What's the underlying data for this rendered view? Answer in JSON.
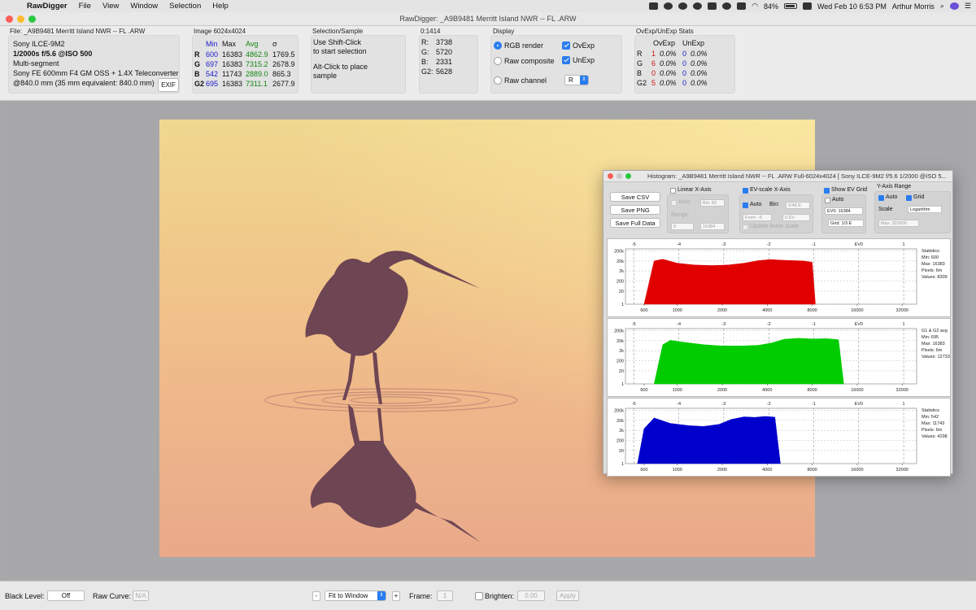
{
  "menubar": {
    "app_name": "RawDigger",
    "items": [
      "File",
      "View",
      "Window",
      "Selection",
      "Help"
    ],
    "battery": "84%",
    "datetime": "Wed Feb 10  6:53 PM",
    "user": "Arthur Morris"
  },
  "window": {
    "title": "RawDigger: _A9B9481  Merritt Island NWR -- FL .ARW"
  },
  "file_panel": {
    "file_label": "File: _A9B9481  Merritt Island NWR -- FL .ARW",
    "camera": "Sony ILCE-9M2",
    "exposure": "1/2000s f/5.6 @ISO 500",
    "metering": "Multi-segment",
    "lens": "Sony FE 600mm F4 GM OSS + 1.4X Teleconverter",
    "focal": "@840.0 mm (35 mm equivalent: 840.0 mm)",
    "exif_button": "EXIF"
  },
  "image_panel": {
    "title": "Image 6024x4024",
    "headers": [
      "Min",
      "Max",
      "Avg",
      "σ"
    ],
    "rows": [
      {
        "ch": "R",
        "min": "600",
        "max": "16383",
        "avg": "4862.9",
        "sd": "1769.5"
      },
      {
        "ch": "G",
        "min": "697",
        "max": "16383",
        "avg": "7315.2",
        "sd": "2678.9"
      },
      {
        "ch": "B",
        "min": "542",
        "max": "11743",
        "avg": "2889.0",
        "sd": "865.3"
      },
      {
        "ch": "G2",
        "min": "695",
        "max": "16383",
        "avg": "7311.1",
        "sd": "2677.9"
      }
    ]
  },
  "selection_panel": {
    "title": "Selection/Sample",
    "line1": "Use Shift-Click",
    "line2": "to start selection",
    "line3": "Alt-Click to place",
    "line4": "sample"
  },
  "sample_panel": {
    "title": "0:1414",
    "rows": [
      {
        "ch": "R:",
        "val": "3738"
      },
      {
        "ch": "G:",
        "val": "5720"
      },
      {
        "ch": "B:",
        "val": "2331"
      },
      {
        "ch": "G2:",
        "val": "5628"
      }
    ]
  },
  "display_panel": {
    "title": "Display",
    "rgb_render": "RGB render",
    "raw_composite": "Raw composite",
    "raw_channel": "Raw channel",
    "ovexp": "OvExp",
    "unexp": "UnExp",
    "channel_value": "R"
  },
  "stats_panel": {
    "title": "OvExp/UnExp Stats",
    "headers": [
      "OvExp",
      "UnExp"
    ],
    "rows": [
      {
        "ch": "R",
        "ov_n": "1",
        "ov_p": "0.0%",
        "un_n": "0",
        "un_p": "0.0%"
      },
      {
        "ch": "G",
        "ov_n": "6",
        "ov_p": "0.0%",
        "un_n": "0",
        "un_p": "0.0%"
      },
      {
        "ch": "B",
        "ov_n": "0",
        "ov_p": "0.0%",
        "un_n": "0",
        "un_p": "0.0%"
      },
      {
        "ch": "G2",
        "ov_n": "5",
        "ov_p": "0.0%",
        "un_n": "0",
        "un_p": "0.0%"
      }
    ]
  },
  "bottombar": {
    "black_level_label": "Black Level:",
    "black_level_value": "Off",
    "raw_curve_label": "Raw Curve:",
    "raw_curve_value": "N/A",
    "minus": "-",
    "plus": "+",
    "zoom_value": "Fit to Window",
    "frame_label": "Frame:",
    "frame_value": "1",
    "brighten_label": "Brighten:",
    "brighten_value": "0.00",
    "apply_label": "Apply"
  },
  "histogram": {
    "title": "Histogram: _A9B9481  Merritt Island NWR -- FL .ARW Full-6024x4024 [ Sony ILCE-9M2 f/5.6 1/2000 @ISO 5...",
    "save_csv": "Save CSV",
    "save_png": "Save PNG",
    "save_full": "Save Full Data",
    "linear_x": "Linear X-Axis",
    "auto": "Auto",
    "bin_field": "Bin: 82",
    "range_label": "Range:",
    "range_from": "0",
    "range_to": "16384",
    "ev_scale": "EV-scale X-Axis",
    "bin_label": "Bin:",
    "bin_value": "1/48 E",
    "from_value": "From: -5",
    "to_value": "0 EV",
    "update_linear": "Update linear scale",
    "show_ev_grid": "Show EV Grid",
    "ev0_value": "EV0: 16384",
    "grid_value": "Grid: 1/3 E",
    "y_range": "Y-Axis Range",
    "grid_label": "Grid",
    "scale_label": "Scale",
    "scale_value": "Logarithm",
    "max_value": "Max: 320000",
    "panels": [
      {
        "color": "#e00000",
        "stats": [
          "Statistics",
          "Min: 600",
          "Max: 16383",
          "Pixels: 6m",
          "Values: 8309"
        ]
      },
      {
        "color": "#00cc00",
        "stats": [
          "G1 & G2 avg",
          "Min: 695",
          "Max: 16383",
          "Pixels: 6m",
          "Values: 12733"
        ]
      },
      {
        "color": "#0000cc",
        "stats": [
          "Statistics",
          "Min: 542",
          "Max: 11743",
          "Pixels: 6m",
          "Values: 4298"
        ]
      }
    ]
  },
  "chart_data": {
    "type": "area",
    "x_scale": "log2",
    "x_ticks": [
      "600",
      "1000",
      "2000",
      "4000",
      "8000",
      "16000",
      "32000"
    ],
    "ev_ticks": [
      "-5",
      "-4",
      "-3",
      "-2",
      "-1",
      "EV0",
      "1"
    ],
    "y_ticks": [
      "200k",
      "20k",
      "2k",
      "200",
      "20",
      "1"
    ],
    "series": [
      {
        "name": "R",
        "x": [
          600,
          700,
          800,
          1000,
          1300,
          1700,
          2200,
          2800,
          3500,
          4200,
          5000,
          6000,
          7000,
          8000,
          8400
        ],
        "y": [
          1,
          20000,
          30000,
          12000,
          8000,
          7000,
          8000,
          12000,
          22000,
          28000,
          24000,
          22000,
          20000,
          15000,
          1
        ]
      },
      {
        "name": "G1 & G2 avg",
        "x": [
          700,
          800,
          900,
          1100,
          1500,
          2000,
          2700,
          3500,
          4300,
          5200,
          6500,
          8000,
          10000,
          12000,
          13000
        ],
        "y": [
          1,
          8000,
          22000,
          14000,
          8000,
          6000,
          6000,
          7000,
          12000,
          28000,
          35000,
          30000,
          32000,
          25000,
          1
        ]
      },
      {
        "name": "B",
        "x": [
          542,
          600,
          700,
          900,
          1200,
          1500,
          1900,
          2300,
          2800,
          3300,
          3900,
          4500,
          4900
        ],
        "y": [
          1,
          3000,
          35000,
          10000,
          6000,
          5000,
          8000,
          25000,
          45000,
          40000,
          50000,
          42000,
          1
        ]
      }
    ]
  }
}
